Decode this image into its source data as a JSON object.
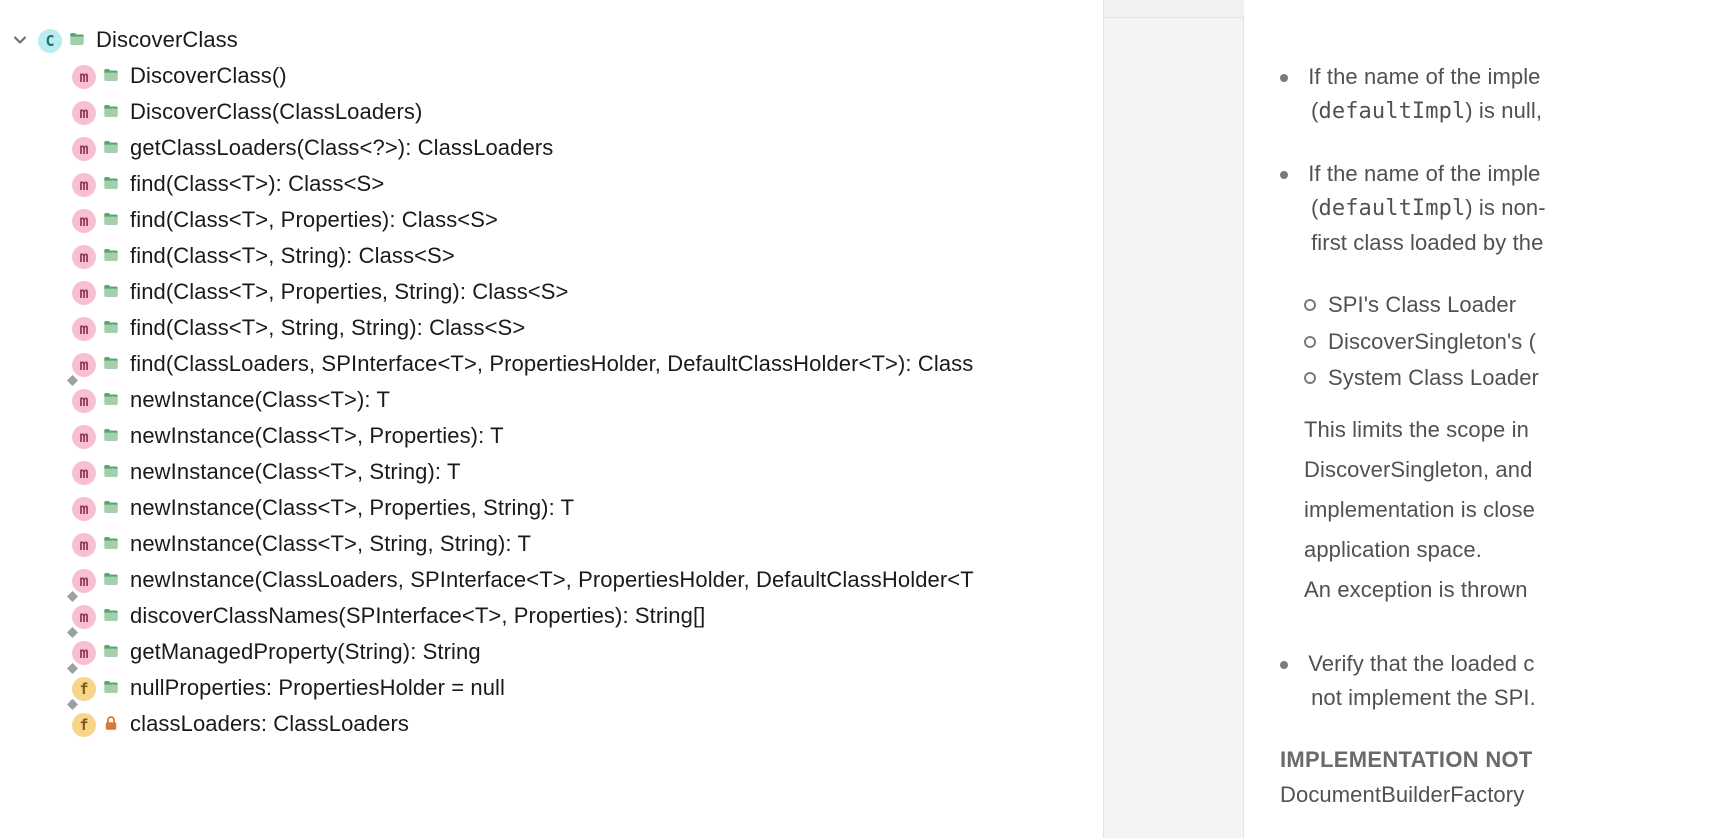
{
  "tree": {
    "root": {
      "kind": "class",
      "visibility": "public",
      "name": "DiscoverClass"
    },
    "members": [
      {
        "kind": "method",
        "visibility": "public",
        "static": false,
        "final": false,
        "sig": "DiscoverClass()"
      },
      {
        "kind": "method",
        "visibility": "public",
        "static": false,
        "final": false,
        "sig": "DiscoverClass(ClassLoaders)"
      },
      {
        "kind": "method",
        "visibility": "public",
        "static": false,
        "final": false,
        "sig": "getClassLoaders(Class<?>): ClassLoaders"
      },
      {
        "kind": "method",
        "visibility": "public",
        "static": false,
        "final": false,
        "sig": "find(Class<T>): Class<S>"
      },
      {
        "kind": "method",
        "visibility": "public",
        "static": false,
        "final": false,
        "sig": "find(Class<T>, Properties): Class<S>"
      },
      {
        "kind": "method",
        "visibility": "public",
        "static": false,
        "final": false,
        "sig": "find(Class<T>, String): Class<S>"
      },
      {
        "kind": "method",
        "visibility": "public",
        "static": false,
        "final": false,
        "sig": "find(Class<T>, Properties, String): Class<S>"
      },
      {
        "kind": "method",
        "visibility": "public",
        "static": false,
        "final": false,
        "sig": "find(Class<T>, String, String): Class<S>"
      },
      {
        "kind": "method",
        "visibility": "public",
        "static": true,
        "final": false,
        "sig": "find(ClassLoaders, SPInterface<T>, PropertiesHolder, DefaultClassHolder<T>): Class"
      },
      {
        "kind": "method",
        "visibility": "public",
        "static": false,
        "final": false,
        "sig": "newInstance(Class<T>): T"
      },
      {
        "kind": "method",
        "visibility": "public",
        "static": false,
        "final": false,
        "sig": "newInstance(Class<T>, Properties): T"
      },
      {
        "kind": "method",
        "visibility": "public",
        "static": false,
        "final": false,
        "sig": "newInstance(Class<T>, String): T"
      },
      {
        "kind": "method",
        "visibility": "public",
        "static": false,
        "final": false,
        "sig": "newInstance(Class<T>, Properties, String): T"
      },
      {
        "kind": "method",
        "visibility": "public",
        "static": false,
        "final": false,
        "sig": "newInstance(Class<T>, String, String): T"
      },
      {
        "kind": "method",
        "visibility": "public",
        "static": true,
        "final": false,
        "sig": "newInstance(ClassLoaders, SPInterface<T>, PropertiesHolder, DefaultClassHolder<T"
      },
      {
        "kind": "method",
        "visibility": "public",
        "static": true,
        "final": false,
        "sig": "discoverClassNames(SPInterface<T>, Properties): String[]"
      },
      {
        "kind": "method",
        "visibility": "public",
        "static": true,
        "final": false,
        "sig": "getManagedProperty(String): String"
      },
      {
        "kind": "field",
        "visibility": "public",
        "static": true,
        "final": true,
        "sig": "nullProperties: PropertiesHolder = null"
      },
      {
        "kind": "field",
        "visibility": "private",
        "static": false,
        "final": false,
        "sig": "classLoaders: ClassLoaders"
      }
    ]
  },
  "doc": {
    "bullets1": [
      {
        "pre": "If the name of the imple",
        "code": "defaultImpl",
        "post": ") is null,"
      }
    ],
    "bullets2": [
      {
        "pre": "If the name of the imple",
        "code": "defaultImpl",
        "post": ") is non-",
        "extra": "first class loaded by the"
      }
    ],
    "circles": [
      "SPI's Class Loader",
      "DiscoverSingleton's (",
      "System Class Loader"
    ],
    "paras": [
      "This limits the scope in",
      "DiscoverSingleton, and",
      "implementation is close",
      "application space.",
      "An exception is thrown"
    ],
    "bullets3": [
      "Verify that the loaded c",
      "not implement the SPI."
    ],
    "heading": "IMPLEMENTATION NOT",
    "afterheading": "DocumentBuilderFactory"
  },
  "badges": {
    "class": "C",
    "method": "m",
    "field": "f"
  }
}
